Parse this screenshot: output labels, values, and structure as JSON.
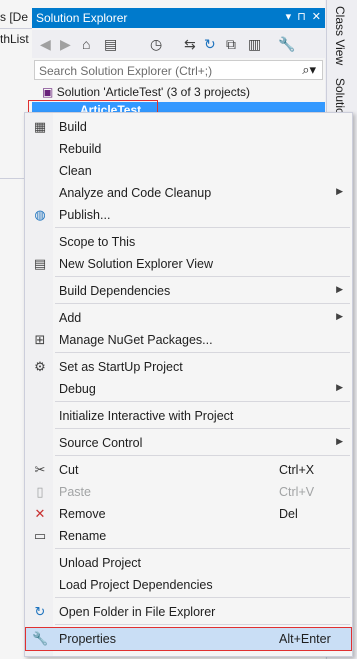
{
  "left_editor": {
    "line1": "s [De",
    "line2": "thList"
  },
  "solution_explorer": {
    "title": "Solution Explorer",
    "title_buttons": [
      "▾",
      "⊓",
      "✕"
    ],
    "search_placeholder": "Search Solution Explorer (Ctrl+;)",
    "solution_label": "Solution 'ArticleTest' (3 of 3 projects)",
    "selected_project": "ArticleTest"
  },
  "right_tabs": {
    "tab1": "Class View",
    "tab2": "Solutio"
  },
  "menu": {
    "items": [
      {
        "label": "Build",
        "shortcut": "",
        "submenu": false,
        "icon": "build-icon",
        "glyph": "▦",
        "disabled": false
      },
      {
        "label": "Rebuild",
        "shortcut": "",
        "submenu": false,
        "icon": "",
        "glyph": "",
        "disabled": false
      },
      {
        "label": "Clean",
        "shortcut": "",
        "submenu": false,
        "icon": "",
        "glyph": "",
        "disabled": false
      },
      {
        "label": "Analyze and Code Cleanup",
        "shortcut": "",
        "submenu": true,
        "icon": "",
        "glyph": "",
        "disabled": false
      },
      {
        "label": "Publish...",
        "shortcut": "",
        "submenu": false,
        "icon": "globe-icon",
        "glyph": "◍",
        "disabled": false
      },
      {
        "label": "Scope to This",
        "shortcut": "",
        "submenu": false,
        "icon": "",
        "glyph": "",
        "disabled": false
      },
      {
        "label": "New Solution Explorer View",
        "shortcut": "",
        "submenu": false,
        "icon": "new-view-icon",
        "glyph": "▤",
        "disabled": false
      },
      {
        "label": "Build Dependencies",
        "shortcut": "",
        "submenu": true,
        "icon": "",
        "glyph": "",
        "disabled": false
      },
      {
        "label": "Add",
        "shortcut": "",
        "submenu": true,
        "icon": "",
        "glyph": "",
        "disabled": false
      },
      {
        "label": "Manage NuGet Packages...",
        "shortcut": "",
        "submenu": false,
        "icon": "nuget-icon",
        "glyph": "⊞",
        "disabled": false
      },
      {
        "label": "Set as StartUp Project",
        "shortcut": "",
        "submenu": false,
        "icon": "gear-icon",
        "glyph": "⚙",
        "disabled": false
      },
      {
        "label": "Debug",
        "shortcut": "",
        "submenu": true,
        "icon": "",
        "glyph": "",
        "disabled": false
      },
      {
        "label": "Initialize Interactive with Project",
        "shortcut": "",
        "submenu": false,
        "icon": "",
        "glyph": "",
        "disabled": false
      },
      {
        "label": "Source Control",
        "shortcut": "",
        "submenu": true,
        "icon": "",
        "glyph": "",
        "disabled": false
      },
      {
        "label": "Cut",
        "shortcut": "Ctrl+X",
        "submenu": false,
        "icon": "scissors-icon",
        "glyph": "✂",
        "disabled": false
      },
      {
        "label": "Paste",
        "shortcut": "Ctrl+V",
        "submenu": false,
        "icon": "paste-icon",
        "glyph": "▯",
        "disabled": true
      },
      {
        "label": "Remove",
        "shortcut": "Del",
        "submenu": false,
        "icon": "remove-icon",
        "glyph": "✕",
        "disabled": false
      },
      {
        "label": "Rename",
        "shortcut": "",
        "submenu": false,
        "icon": "rename-icon",
        "glyph": "▭",
        "disabled": false
      },
      {
        "label": "Unload Project",
        "shortcut": "",
        "submenu": false,
        "icon": "",
        "glyph": "",
        "disabled": false
      },
      {
        "label": "Load Project Dependencies",
        "shortcut": "",
        "submenu": false,
        "icon": "",
        "glyph": "",
        "disabled": false
      },
      {
        "label": "Open Folder in File Explorer",
        "shortcut": "",
        "submenu": false,
        "icon": "refresh-folder-icon",
        "glyph": "↻",
        "disabled": false
      },
      {
        "label": "Properties",
        "shortcut": "Alt+Enter",
        "submenu": false,
        "icon": "wrench-icon",
        "glyph": "🔧",
        "disabled": false,
        "highlighted": true
      }
    ]
  },
  "colors": {
    "accent": "#007acc",
    "selection": "#3399ff",
    "highlight": "#c9def5",
    "highlight_border": "#e03030"
  }
}
